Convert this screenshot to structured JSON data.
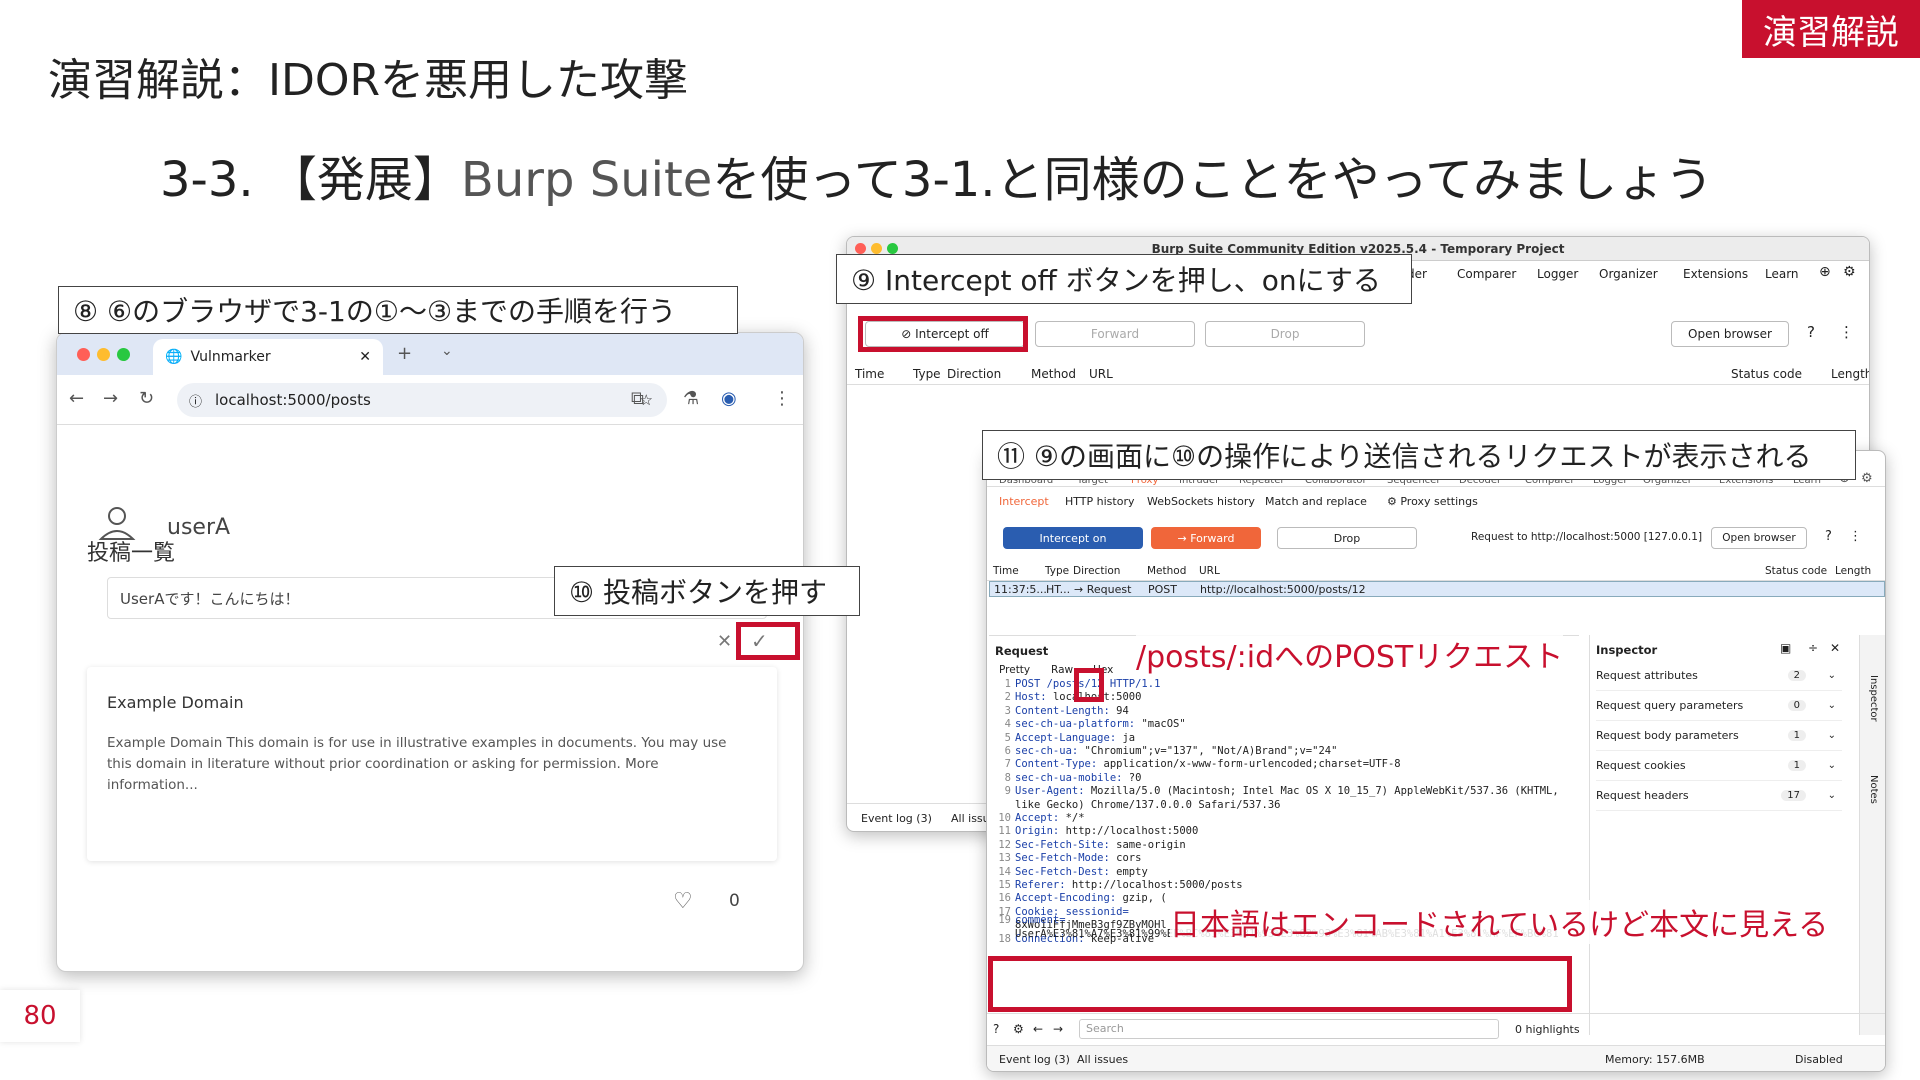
{
  "slide": {
    "tag": "演習解説",
    "title": "演習解説：IDORを悪用した攻撃",
    "subtitle_prefix": "3-3. 【発展】",
    "subtitle_highlight": "Burp Suite",
    "subtitle_suffix": "を使って3-1.と同様のことをやってみましょう",
    "page_number": "80"
  },
  "callouts": {
    "step8": "⑧ ⑥のブラウザで3-1の①〜③までの手順を行う",
    "step9": "⑨ Intercept off ボタンを押し、onにする",
    "step10": "⑩ 投稿ボタンを押す",
    "step11": "⑪ ⑨の画面に⑩の操作により送信されるリクエストが表示される",
    "note_post": "/posts/:idへのPOSTリクエスト",
    "note_encode": "日本語はエンコードされているけど本文に見える"
  },
  "browser": {
    "tab_title": "Vulnmarker",
    "url": "localhost:5000/posts",
    "page_heading": "投稿一覧",
    "username": "userA",
    "post_input_value": "UserAです！こんにちは！",
    "card_title": "Example Domain",
    "card_body": "Example Domain This domain is for use in illustrative examples in documents. You may use this domain in literature without prior coordination or asking for permission. More information...",
    "like_count": "0"
  },
  "burp1": {
    "window_title": "Burp Suite Community Edition v2025.5.4 - Temporary Project",
    "menu": [
      "der",
      "Comparer",
      "Logger",
      "Organizer",
      "Extensions",
      "Learn"
    ],
    "intercept_button": "Intercept off",
    "forward_button": "Forward",
    "drop_button": "Drop",
    "open_browser": "Open browser",
    "columns": [
      "Time",
      "Type",
      "Direction",
      "Method",
      "URL",
      "Status code",
      "Length"
    ],
    "footer": [
      "Event log (3)",
      "All issu"
    ]
  },
  "burp2": {
    "top_menu": [
      "Dashboard",
      "Target",
      "Proxy",
      "Intruder",
      "Repeater",
      "Collaborator",
      "Sequencer",
      "Decoder",
      "Comparer",
      "Logger",
      "Organizer",
      "Extensions",
      "Learn"
    ],
    "tabs": [
      "Intercept",
      "HTTP history",
      "WebSockets history",
      "Match and replace",
      "Proxy settings"
    ],
    "intercept_button": "Intercept on",
    "forward_button": "Forward",
    "drop_button": "Drop",
    "request_to": "Request to http://localhost:5000  [127.0.0.1]",
    "open_browser": "Open browser",
    "columns": [
      "Time",
      "Type",
      "Direction",
      "Method",
      "URL",
      "Status code",
      "Length"
    ],
    "row": {
      "time": "11:37:5...",
      "type": "HT...",
      "direction": "→  Request",
      "method": "POST",
      "url": "http://localhost:5000/posts/12"
    },
    "request_label": "Request",
    "view_tabs": [
      "Pretty",
      "Raw",
      "Hex"
    ],
    "request_lines": [
      {
        "n": "1",
        "k": "POST /posts/12 HTTP/1.1",
        "v": ""
      },
      {
        "n": "2",
        "k": "Host: ",
        "v": "localhost:5000"
      },
      {
        "n": "3",
        "k": "Content-Length: ",
        "v": "94"
      },
      {
        "n": "4",
        "k": "sec-ch-ua-platform: ",
        "v": "\"macOS\""
      },
      {
        "n": "5",
        "k": "Accept-Language: ",
        "v": "ja"
      },
      {
        "n": "6",
        "k": "sec-ch-ua: ",
        "v": "\"Chromium\";v=\"137\", \"Not/A)Brand\";v=\"24\""
      },
      {
        "n": "7",
        "k": "Content-Type: ",
        "v": "application/x-www-form-urlencoded;charset=UTF-8"
      },
      {
        "n": "8",
        "k": "sec-ch-ua-mobile: ",
        "v": "?0"
      },
      {
        "n": "9",
        "k": "User-Agent: ",
        "v": "Mozilla/5.0 (Macintosh; Intel Mac OS X 10_15_7) AppleWebKit/537.36 (KHTML,"
      },
      {
        "n": "",
        "k": "",
        "v": "like Gecko) Chrome/137.0.0.0 Safari/537.36"
      },
      {
        "n": "10",
        "k": "Accept: ",
        "v": "*/*"
      },
      {
        "n": "11",
        "k": "Origin: ",
        "v": "http://localhost:5000"
      },
      {
        "n": "12",
        "k": "Sec-Fetch-Site: ",
        "v": "same-origin"
      },
      {
        "n": "13",
        "k": "Sec-Fetch-Mode: ",
        "v": "cors"
      },
      {
        "n": "14",
        "k": "Sec-Fetch-Dest: ",
        "v": "empty"
      },
      {
        "n": "15",
        "k": "Referer: ",
        "v": "http://localhost:5000/posts"
      },
      {
        "n": "16",
        "k": "Accept-Encoding: ",
        "v": "gzip, ("
      },
      {
        "n": "17",
        "k": "Cookie: sessionid=",
        "v": ""
      },
      {
        "n": "",
        "k": "",
        "v": "8xWo1iFfjMmeB3gf9ZByMOHl"
      },
      {
        "n": "18",
        "k": "Connection: ",
        "v": "keep-alive"
      }
    ],
    "body_key": "comment=",
    "body_value": "UserA%E3%81%A7%E3%81%99%EF%BC%81%E3%81%93%E3%82%93%E3%81%AB%E3%81%A1%E3%81%AF%EF%BC%81",
    "inspector_title": "Inspector",
    "inspector_rows": [
      {
        "label": "Request attributes",
        "count": "2"
      },
      {
        "label": "Request query parameters",
        "count": "0"
      },
      {
        "label": "Request body parameters",
        "count": "1"
      },
      {
        "label": "Request cookies",
        "count": "1"
      },
      {
        "label": "Request headers",
        "count": "17"
      }
    ],
    "side_labels": [
      "Inspector",
      "Notes"
    ],
    "search_placeholder": "Search",
    "highlights": "0 highlights",
    "footer_left": [
      "Event log (3)",
      "All issues"
    ],
    "memory": "Memory: 157.6MB",
    "disabled": "Disabled"
  }
}
